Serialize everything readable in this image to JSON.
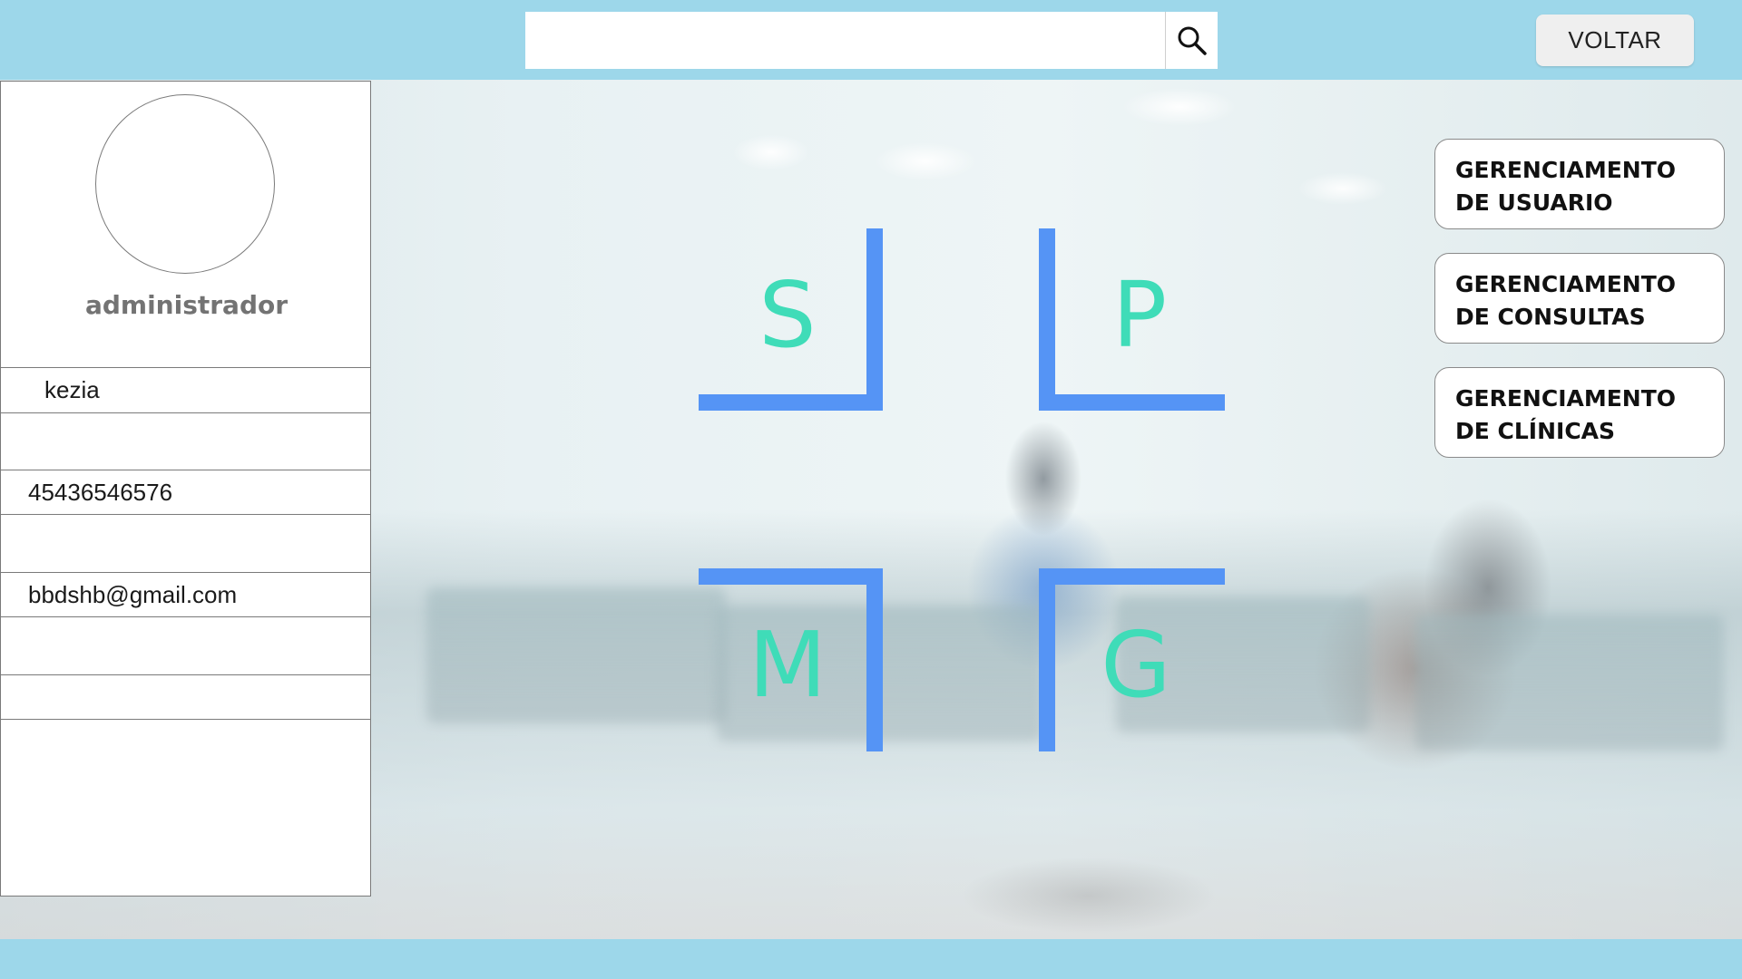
{
  "header": {
    "search_placeholder": "",
    "search_icon": "search-icon",
    "back_label": "VOLTAR"
  },
  "profile": {
    "role": "administrador",
    "fields": [
      "kezia",
      "",
      "45436546576",
      "",
      "bbdshb@gmail.com",
      "",
      ""
    ]
  },
  "logo": {
    "letters": [
      "S",
      "P",
      "M",
      "G"
    ],
    "line_color": "#5594f5",
    "letter_color": "#3fdcb8"
  },
  "menu": {
    "items": [
      "GERENCIAMENTO DE USUARIO",
      "GERENCIAMENTO DE CONSULTAS",
      "GERENCIAMENTO DE CLÍNICAS"
    ]
  },
  "colors": {
    "bar": "#9dd7ea",
    "button": "#efefef"
  }
}
